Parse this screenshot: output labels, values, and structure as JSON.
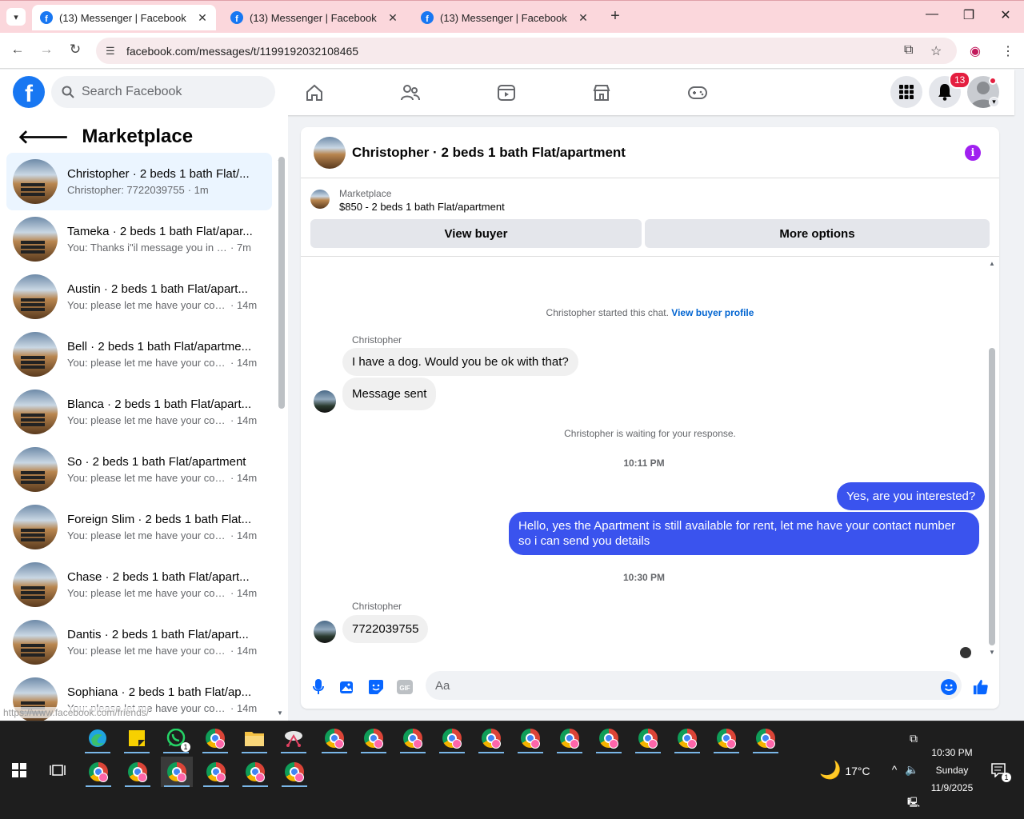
{
  "browser": {
    "tabs": [
      {
        "title": "(13) Messenger | Facebook",
        "active": true
      },
      {
        "title": "(13) Messenger | Facebook",
        "active": false
      },
      {
        "title": "(13) Messenger | Facebook",
        "active": false
      }
    ],
    "url": "facebook.com/messages/t/1199192032108465",
    "new_tab_symbol": "+",
    "status_url": "https://www.facebook.com/friends/"
  },
  "fb": {
    "logo_letter": "f",
    "search_placeholder": "Search Facebook",
    "notification_count": "13",
    "nav_icons": [
      "home-icon",
      "friends-icon",
      "video-icon",
      "marketplace-icon",
      "gaming-icon"
    ]
  },
  "left": {
    "title": "Marketplace",
    "conversations": [
      {
        "name": "Christopher · 2 beds 1 bath Flat/...",
        "msg": "Christopher: 7722039755",
        "time": "· 1m",
        "active": true
      },
      {
        "name": "Tameka · 2 beds 1 bath Flat/apar...",
        "msg": "You: Thanks i\"il message you in a ...",
        "time": "· 7m"
      },
      {
        "name": "Austin · 2 beds 1 bath Flat/apart...",
        "msg": "You: please let me have your cont...",
        "time": "· 14m"
      },
      {
        "name": "Bell · 2 beds 1 bath Flat/apartme...",
        "msg": "You: please let me have your cont...",
        "time": "· 14m"
      },
      {
        "name": "Blanca · 2 beds 1 bath Flat/apart...",
        "msg": "You: please let me have your cont...",
        "time": "· 14m"
      },
      {
        "name": "So · 2 beds 1 bath Flat/apartment",
        "msg": "You: please let me have your cont...",
        "time": "· 14m"
      },
      {
        "name": "Foreign Slim · 2 beds 1 bath Flat...",
        "msg": "You: please let me have your cont...",
        "time": "· 14m"
      },
      {
        "name": "Chase · 2 beds 1 bath Flat/apart...",
        "msg": "You: please let me have your cont...",
        "time": "· 14m"
      },
      {
        "name": "Dantis · 2 beds 1 bath Flat/apart...",
        "msg": "You: please let me have your cont...",
        "time": "· 14m"
      },
      {
        "name": "Sophiana · 2 beds 1 bath Flat/ap...",
        "msg": "You: please let me have your cont...",
        "time": "· 14m"
      }
    ]
  },
  "chat": {
    "title": "Christopher · 2 beds 1 bath Flat/apartment",
    "marketplace_label": "Marketplace",
    "listing": "$850 - 2 beds 1 bath Flat/apartment",
    "view_buyer": "View buyer",
    "more_options": "More options",
    "started_text": "Christopher started this chat.",
    "view_buyer_profile": "View buyer profile",
    "sender_name": "Christopher",
    "msg1": "I have a dog. Would you be ok with that?",
    "msg2": "Message sent",
    "waiting": "Christopher is waiting for your response.",
    "time1": "10:11 PM",
    "out1": "Yes, are you interested?",
    "out2": "Hello, yes the Apartment is still available for rent, let me have your contact number so i can send you details",
    "time2": "10:30 PM",
    "msg3": "7722039755",
    "composer_placeholder": "Aa"
  },
  "taskbar": {
    "weather": "17°C",
    "time": "10:30 PM",
    "day": "Sunday",
    "date": "11/9/2025",
    "whatsapp_badge": "1",
    "notif_badge": "1"
  },
  "colors": {
    "accent": "#3a53ee",
    "fb_blue": "#1877f2",
    "tab_bar": "#fbd7dc"
  }
}
